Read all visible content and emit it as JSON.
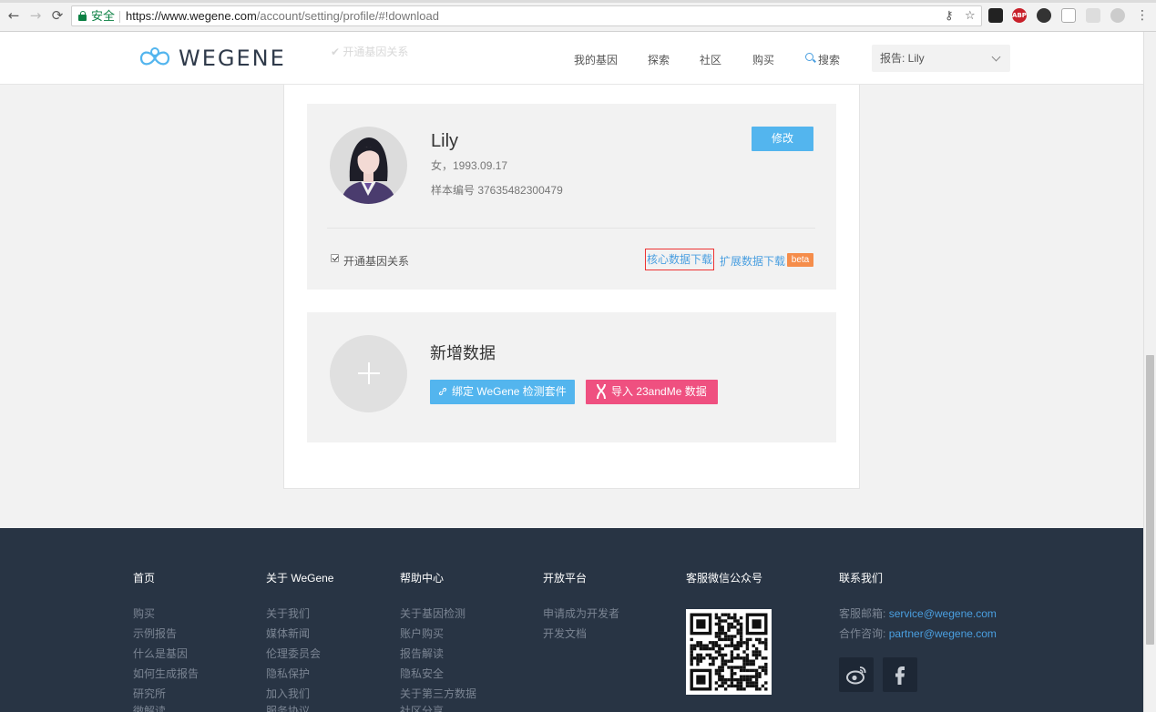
{
  "browser": {
    "secure_label": "安全",
    "url_main": "https://www.wegene.com",
    "url_rest": "/account/setting/profile/#!download",
    "back_glyph": "←",
    "forward_glyph": "→",
    "reload_glyph": "⟳",
    "star_glyph": "☆",
    "key_glyph": "⚷",
    "menu_glyph": "⋮",
    "abp_label": "ABP"
  },
  "header": {
    "logo_text": "WEGENE",
    "nav": [
      "我的基因",
      "探索",
      "社区",
      "购买"
    ],
    "search_label": "搜索",
    "report_select": "报告: Lily"
  },
  "ghost": {
    "left_text": "✔ 开通基因关系",
    "right_text": "扩展数据下载"
  },
  "profile": {
    "name": "Lily",
    "gender_birth": "女，1993.09.17",
    "sample_id": "样本编号 37635482300479",
    "edit_label": "修改",
    "gene_relation_label": "开通基因关系",
    "core_download": "核心数据下载",
    "ext_download": "扩展数据下载",
    "beta": "beta"
  },
  "add_data": {
    "title": "新增数据",
    "bind_label": "绑定 WeGene 检测套件",
    "import_label": "导入 23andMe 数据"
  },
  "footer": {
    "col1": {
      "head": "首页",
      "links": [
        "购买",
        "示例报告",
        "什么是基因",
        "如何生成报告",
        "研究所",
        "微解读"
      ]
    },
    "col2": {
      "head": "关于 WeGene",
      "links": [
        "关于我们",
        "媒体新闻",
        "伦理委员会",
        "隐私保护",
        "加入我们",
        "服务协议"
      ]
    },
    "col3": {
      "head": "帮助中心",
      "links": [
        "关于基因检测",
        "账户购买",
        "报告解读",
        "隐私安全",
        "关于第三方数据",
        "社区分享"
      ]
    },
    "col4": {
      "head": "开放平台",
      "links": [
        "申请成为开发者",
        "开发文档"
      ]
    },
    "col5": {
      "head": "客服微信公众号"
    },
    "col6": {
      "head": "联系我们",
      "email_label": "客服邮箱:",
      "email": "service@wegene.com",
      "partner_label": "合作咨询:",
      "partner": "partner@wegene.com"
    }
  },
  "colors": {
    "brand_blue": "#53b5ee",
    "link_blue": "#4a9fe0",
    "pink": "#ef5080",
    "beta_orange": "#f58d4b",
    "footer_bg": "#283444",
    "highlight_red": "#e33"
  }
}
